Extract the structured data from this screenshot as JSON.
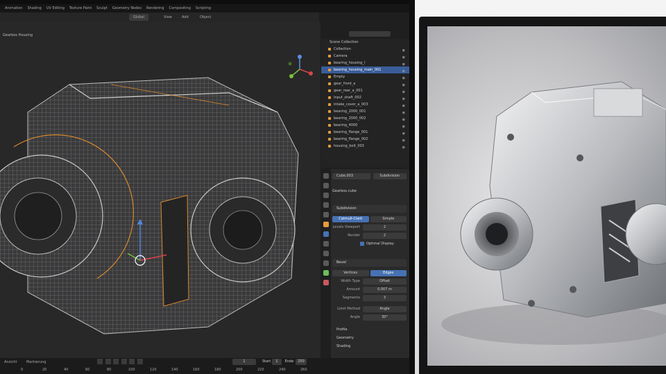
{
  "menubar": [
    "Animation",
    "Shading",
    "UV Editing",
    "Texture Paint",
    "Sculpt",
    "Geometry Nodes",
    "Rendering",
    "Compositing",
    "Scripting"
  ],
  "header": {
    "transform": "Global",
    "view": "View",
    "add": "Add",
    "object": "Object"
  },
  "viewport": {
    "title": "Gearbox Housing"
  },
  "outliner": {
    "title": "Scene Collection",
    "items": [
      {
        "label": "Collection",
        "selected": false
      },
      {
        "label": "Camera",
        "selected": false
      },
      {
        "label": "bearing_housing_l",
        "selected": false
      },
      {
        "label": "bearing_housing_main_001",
        "selected": true
      },
      {
        "label": "Empty",
        "selected": false
      },
      {
        "label": "gear_front_a",
        "selected": false
      },
      {
        "label": "gear_rear_a_001",
        "selected": false
      },
      {
        "label": "input_shaft_002",
        "selected": false
      },
      {
        "label": "intake_cover_a_003",
        "selected": false
      },
      {
        "label": "bearing_2000_001",
        "selected": false
      },
      {
        "label": "bearing_2000_002",
        "selected": false
      },
      {
        "label": "bearing_4000",
        "selected": false
      },
      {
        "label": "bearing_flange_001",
        "selected": false
      },
      {
        "label": "bearing_flange_002",
        "selected": false
      },
      {
        "label": "housing_bolt_003",
        "selected": false
      }
    ]
  },
  "properties": {
    "object_name": "Cube.003",
    "modifier_bar": "Subdivision",
    "data_name": "Gearbox.cube",
    "subdiv_panel": "Subdivision",
    "tabs": [
      "Catmull-Clark",
      "Simple"
    ],
    "levels_viewport_label": "Levels Viewport",
    "levels_viewport": "2",
    "render_label": "Render",
    "render": "2",
    "optimal_display": "Optimal Display",
    "bevel_panel": "Bevel",
    "bevel_tabs": [
      "Vertices",
      "Edges"
    ],
    "width_type_label": "Width Type",
    "width_type": "Offset",
    "amount_label": "Amount",
    "amount": "0.007 m",
    "segments_label": "Segments",
    "segments": "3",
    "limit_method_label": "Limit Method",
    "limit_method": "Angle",
    "angle_label": "Angle",
    "angle": "30°",
    "profile": "Profile",
    "geometry": "Geometry",
    "shading": "Shading"
  },
  "timeline": {
    "view": "Ansicht",
    "marker": "Markierung",
    "frame": "1",
    "start_label": "Start",
    "start": "1",
    "end_label": "Ende",
    "end": "250",
    "ticks": [
      "0",
      "20",
      "40",
      "60",
      "80",
      "100",
      "120",
      "140",
      "160",
      "180",
      "200",
      "220",
      "240",
      "260"
    ]
  },
  "colors": {
    "accent": "#4772b3",
    "selection": "#e59b3b"
  }
}
